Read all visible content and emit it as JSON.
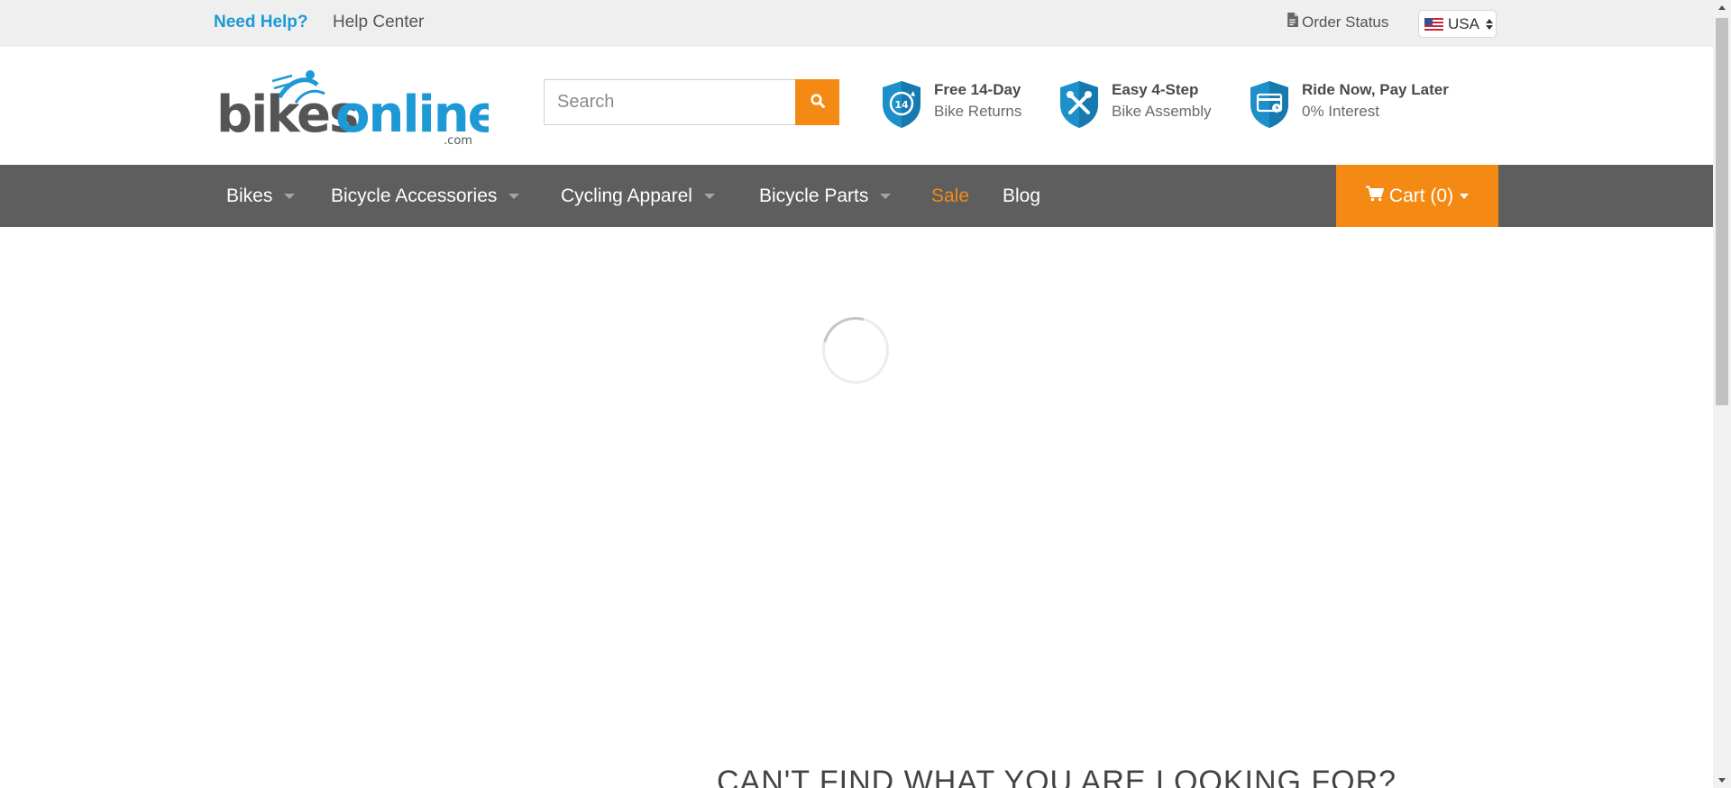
{
  "colors": {
    "accent_orange": "#f48a14",
    "brand_blue": "#1d9ad6",
    "nav_background": "#5e5e5e",
    "topbar_background": "#efefef"
  },
  "topbar": {
    "need_help": "Need Help?",
    "help_center": "Help Center",
    "order_status": "Order Status",
    "order_status_icon": "document-icon",
    "country": "USA",
    "country_flag_icon": "us-flag-icon"
  },
  "header": {
    "logo": {
      "primary": "bikes",
      "secondary": "online",
      "suffix": ".com"
    },
    "search": {
      "placeholder": "Search",
      "value": "",
      "button_icon": "search-icon"
    },
    "features": [
      {
        "icon": "returns-shield-icon",
        "title": "Free 14-Day",
        "subtitle": "Bike Returns"
      },
      {
        "icon": "assembly-shield-icon",
        "title": "Easy 4-Step",
        "subtitle": "Bike Assembly"
      },
      {
        "icon": "payment-shield-icon",
        "title": "Ride Now, Pay Later",
        "subtitle": "0% Interest"
      }
    ]
  },
  "nav": {
    "items": [
      {
        "label": "Bikes",
        "has_dropdown": true
      },
      {
        "label": "Bicycle Accessories",
        "has_dropdown": true
      },
      {
        "label": "Cycling Apparel",
        "has_dropdown": true
      },
      {
        "label": "Bicycle Parts",
        "has_dropdown": true
      },
      {
        "label": "Sale",
        "has_dropdown": false
      },
      {
        "label": "Blog",
        "has_dropdown": false
      }
    ],
    "cart": {
      "label": "Cart (0)",
      "icon": "cart-icon"
    }
  },
  "main": {
    "loading_indicator": "loading-spinner",
    "cant_find_heading": "CAN'T FIND WHAT YOU ARE LOOKING FOR?"
  }
}
